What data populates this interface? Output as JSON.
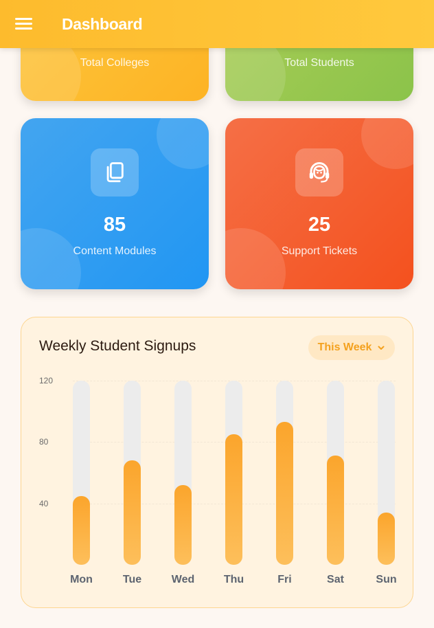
{
  "header": {
    "title": "Dashboard",
    "menu_icon": "menu-icon"
  },
  "stats": {
    "colleges": {
      "label": "Total Colleges"
    },
    "students": {
      "label": "Total Students"
    },
    "modules": {
      "value": "85",
      "label": "Content Modules",
      "icon": "copy-icon"
    },
    "tickets": {
      "value": "25",
      "label": "Support Tickets",
      "icon": "headset-icon"
    }
  },
  "colors": {
    "header": "#fdbb2d",
    "colleges": "#fdb324",
    "students": "#8bc34a",
    "modules": "#2196f3",
    "tickets": "#f4511e",
    "bar": "#fba52c"
  },
  "chart": {
    "title": "Weekly Student Signups",
    "period": "This Week"
  },
  "chart_data": {
    "type": "bar",
    "title": "Weekly Student Signups",
    "categories": [
      "Mon",
      "Tue",
      "Wed",
      "Thu",
      "Fri",
      "Sat",
      "Sun"
    ],
    "values": [
      45,
      68,
      52,
      85,
      93,
      71,
      34
    ],
    "yticks": [
      "120",
      "80",
      "40"
    ],
    "ylim": [
      0,
      120
    ],
    "grid": true,
    "xlabel": "",
    "ylabel": ""
  }
}
